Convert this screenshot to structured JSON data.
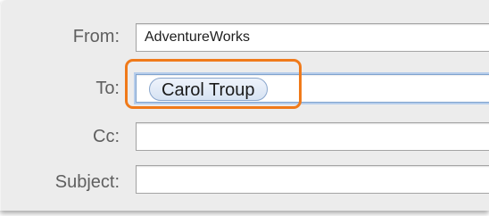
{
  "compose_header": {
    "from": {
      "label": "From:",
      "value": "AdventureWorks"
    },
    "to": {
      "label": "To:",
      "recipients": [
        {
          "name": "Carol Troup"
        }
      ]
    },
    "cc": {
      "label": "Cc:",
      "value": ""
    },
    "subject": {
      "label": "Subject:",
      "value": ""
    }
  },
  "colors": {
    "highlight": "#f07a1a",
    "token_border": "#8aa6cc",
    "focus_ring": "#b6cdeb"
  }
}
